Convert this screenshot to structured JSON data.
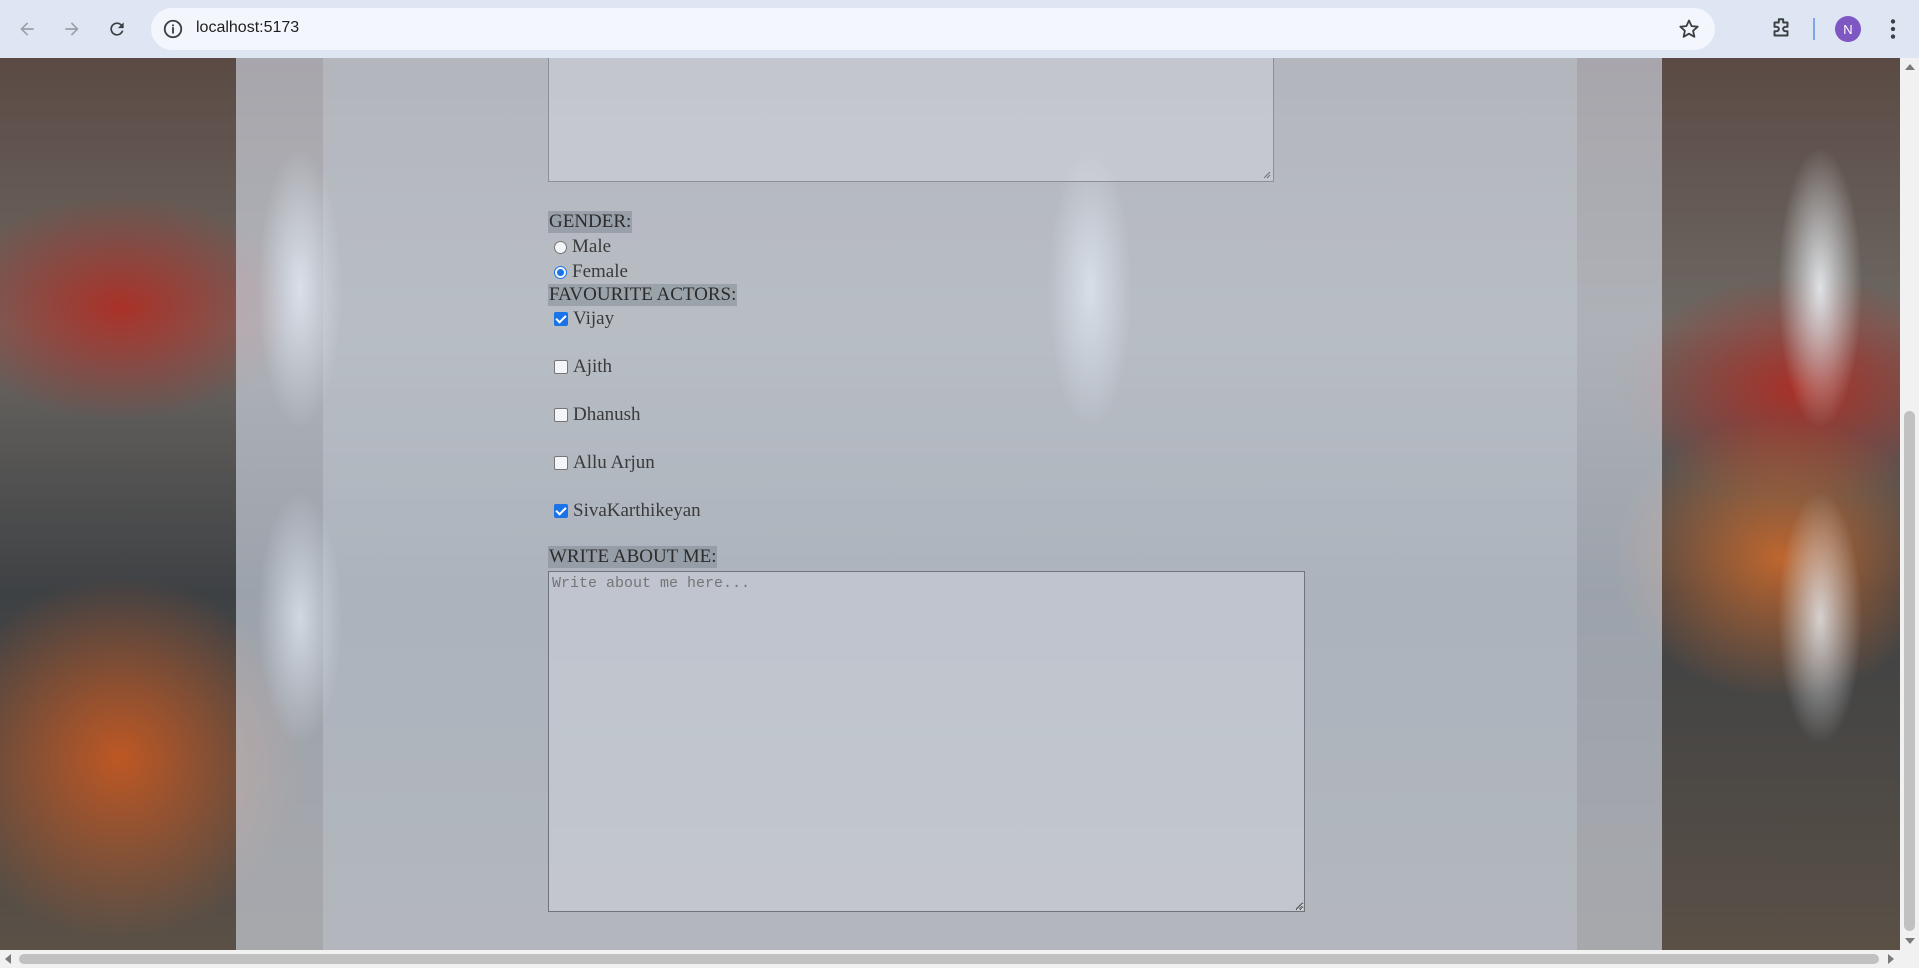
{
  "browser": {
    "url": "localhost:5173",
    "profile_initial": "N",
    "icons": {
      "back": "arrow-left-icon",
      "forward": "arrow-right-icon",
      "reload": "reload-icon",
      "site_info": "info-icon",
      "bookmark": "star-icon",
      "extensions": "puzzle-icon",
      "menu": "kebab-menu-icon"
    }
  },
  "form": {
    "gender": {
      "label": "GENDER:",
      "options": [
        {
          "label": "Male",
          "selected": false
        },
        {
          "label": "Female",
          "selected": true
        }
      ]
    },
    "actors": {
      "label": "FAVOURITE ACTORS:",
      "options": [
        {
          "label": "Vijay",
          "checked": true
        },
        {
          "label": "Ajith",
          "checked": false
        },
        {
          "label": "Dhanush",
          "checked": false
        },
        {
          "label": "Allu Arjun",
          "checked": false
        },
        {
          "label": "SivaKarthikeyan",
          "checked": true
        }
      ]
    },
    "about": {
      "label": "WRITE ABOUT ME:",
      "placeholder": "Write about me here...",
      "value": ""
    }
  },
  "colors": {
    "accent": "#1a73e8",
    "avatar": "#7e57c2"
  }
}
